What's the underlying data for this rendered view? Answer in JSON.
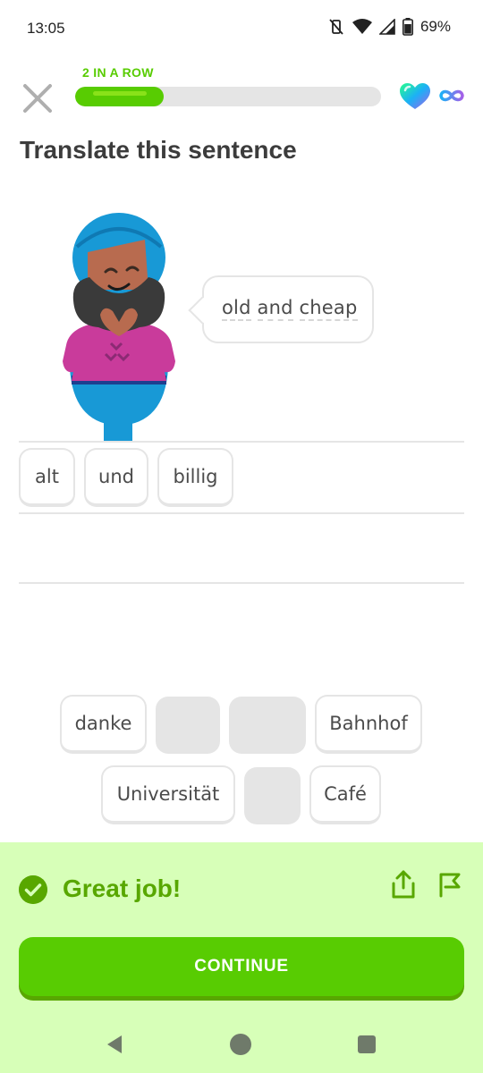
{
  "status_bar": {
    "time": "13:05",
    "battery": "69%",
    "icons": [
      "mute-vibrate-icon",
      "wifi-icon",
      "signal-icon",
      "battery-icon"
    ]
  },
  "header": {
    "streak_label": "2 IN A ROW",
    "progress_fraction": 0.29,
    "icons": [
      "close-icon",
      "heart-icon",
      "infinity-icon"
    ]
  },
  "prompt": {
    "title": "Translate this sentence",
    "bubble_words": [
      "old",
      "and",
      "cheap"
    ]
  },
  "answer_tiles": [
    "alt",
    "und",
    "billig"
  ],
  "word_bank": {
    "row1": [
      {
        "text": "danke",
        "used": false
      },
      {
        "text": "",
        "used": true
      },
      {
        "text": "",
        "used": true
      },
      {
        "text": "Bahnhof",
        "used": false
      }
    ],
    "row2": [
      {
        "text": "Universität",
        "used": false
      },
      {
        "text": "",
        "used": true
      },
      {
        "text": "Café",
        "used": false
      }
    ]
  },
  "feedback": {
    "title": "Great job!",
    "continue_label": "CONTINUE",
    "icons": [
      "check-icon",
      "share-icon",
      "flag-icon"
    ]
  },
  "colors": {
    "brand_green": "#58cc02",
    "dark_green": "#58a700",
    "feedback_bg": "#d7ffb8",
    "tile_border": "#e5e5e5",
    "text": "#3c3c3c"
  }
}
